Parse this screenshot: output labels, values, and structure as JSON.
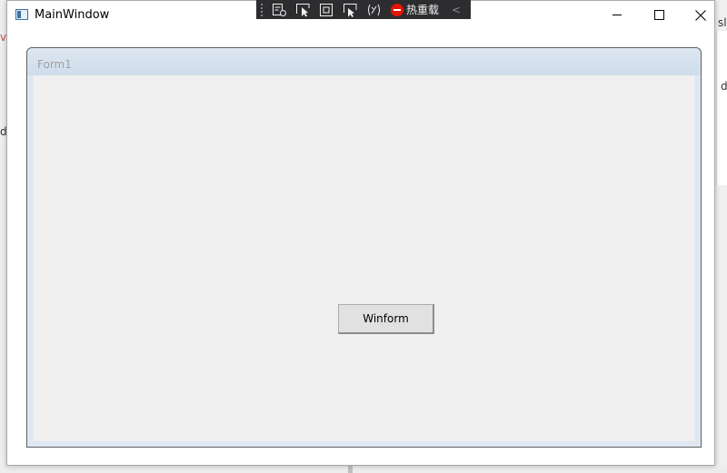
{
  "window": {
    "title": "MainWindow"
  },
  "devbar": {
    "hot_reload_label": "热重载",
    "icons": [
      "live-visual-tree-icon",
      "select-element-icon",
      "display-adorners-icon",
      "track-focus-icon",
      "binding-failures-icon"
    ],
    "collapse_glyph": "<"
  },
  "form": {
    "title": "Form1",
    "button_label": "Winform"
  },
  "background": {
    "left_fragment_1": "v",
    "left_fragment_2": "d",
    "right_fragment_1": "sl",
    "right_fragment_2": "d"
  },
  "colors": {
    "devbar_bg": "#2d2d30",
    "stop_red": "#e51400",
    "form_title_bg": "#dde7f2"
  }
}
